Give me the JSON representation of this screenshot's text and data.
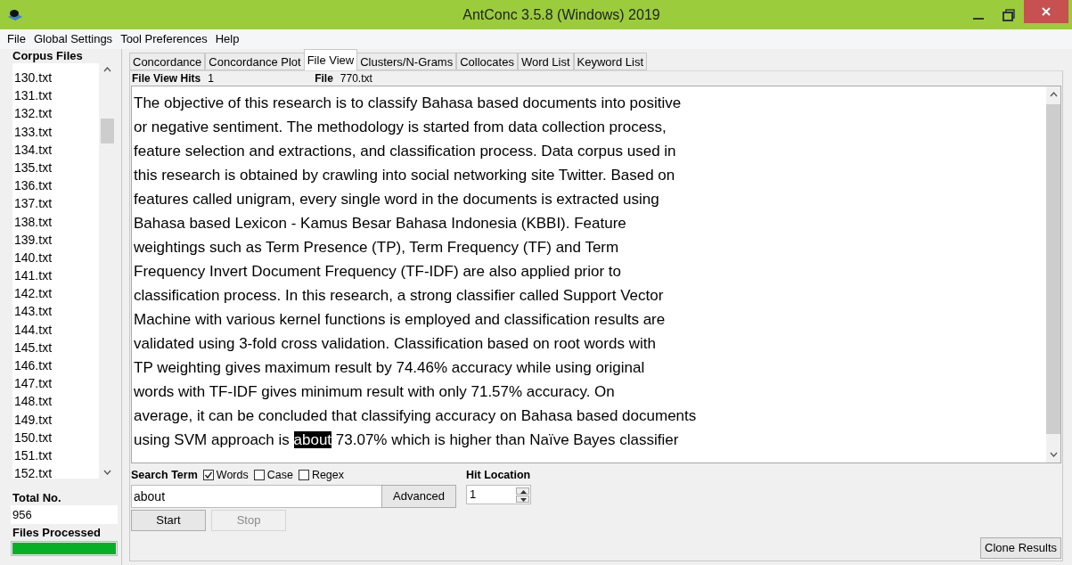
{
  "window": {
    "title": "AntConc 3.5.8 (Windows) 2019"
  },
  "menu": [
    "File",
    "Global Settings",
    "Tool Preferences",
    "Help"
  ],
  "corpus_files": {
    "label": "Corpus Files",
    "items": [
      "130.txt",
      "131.txt",
      "132.txt",
      "133.txt",
      "134.txt",
      "135.txt",
      "136.txt",
      "137.txt",
      "138.txt",
      "139.txt",
      "140.txt",
      "141.txt",
      "142.txt",
      "143.txt",
      "144.txt",
      "145.txt",
      "146.txt",
      "147.txt",
      "148.txt",
      "149.txt",
      "150.txt",
      "151.txt",
      "152.txt"
    ]
  },
  "total": {
    "label": "Total No.",
    "value": "956"
  },
  "files_processed": {
    "label": "Files Processed",
    "level": 1
  },
  "tabs": [
    {
      "label": "Concordance",
      "selected": false
    },
    {
      "label": "Concordance Plot",
      "selected": false
    },
    {
      "label": "File View",
      "selected": true
    },
    {
      "label": "Clusters/N-Grams",
      "selected": false
    },
    {
      "label": "Collocates",
      "selected": false
    },
    {
      "label": "Word List",
      "selected": false
    },
    {
      "label": "Keyword List",
      "selected": false
    }
  ],
  "file_view": {
    "hits_label": "File View Hits",
    "hits": "1",
    "file_label": "File",
    "file": "770.txt"
  },
  "text_lines": [
    [
      {
        "text": "The objective of this research is to classify Bahasa based documents into positive",
        "highlighted": false
      }
    ],
    [
      {
        "text": "or negative sentiment. The methodology is started from data collection process,",
        "highlighted": false
      }
    ],
    [
      {
        "text": "feature selection and extractions, and classification process. Data corpus used in",
        "highlighted": false
      }
    ],
    [
      {
        "text": "this research is obtained by crawling into social networking site Twitter. Based on",
        "highlighted": false
      }
    ],
    [
      {
        "text": "features called unigram, every single word in the documents is extracted using",
        "highlighted": false
      }
    ],
    [
      {
        "text": "Bahasa based Lexicon - Kamus Besar Bahasa Indonesia (KBBI). Feature",
        "highlighted": false
      }
    ],
    [
      {
        "text": "weightings such as Term Presence (TP), Term Frequency (TF) and Term",
        "highlighted": false
      }
    ],
    [
      {
        "text": "Frequency Invert Document Frequency (TF-IDF) are also applied prior to",
        "highlighted": false
      }
    ],
    [
      {
        "text": "classification process. In this research, a strong classifier called Support Vector",
        "highlighted": false
      }
    ],
    [
      {
        "text": "Machine with various kernel functions is employed and classification results are",
        "highlighted": false
      }
    ],
    [
      {
        "text": "validated using 3-fold cross validation. Classification based on root words with",
        "highlighted": false
      }
    ],
    [
      {
        "text": "TP weighting gives maximum result by 74.46% accuracy while using original",
        "highlighted": false
      }
    ],
    [
      {
        "text": "words with TF-IDF gives minimum result with only 71.57% accuracy. On",
        "highlighted": false
      }
    ],
    [
      {
        "text": "average, it can be concluded that classifying accuracy on Bahasa based documents",
        "highlighted": false
      }
    ],
    [
      {
        "text": "using SVM approach is ",
        "highlighted": false
      },
      {
        "text": "about",
        "highlighted": true
      },
      {
        "text": " 73.07% which is higher than Naïve Bayes classifier",
        "highlighted": false
      }
    ]
  ],
  "search": {
    "label": "Search Term",
    "options": [
      {
        "label": "Words",
        "checked": true
      },
      {
        "label": "Case",
        "checked": false
      },
      {
        "label": "Regex",
        "checked": false
      }
    ],
    "value": "about",
    "advanced": "Advanced"
  },
  "hit_location": {
    "label": "Hit Location",
    "value": "1"
  },
  "buttons": [
    {
      "label": "Start",
      "disabled": false
    },
    {
      "label": "Stop",
      "disabled": true
    }
  ],
  "clone": "Clone Results"
}
